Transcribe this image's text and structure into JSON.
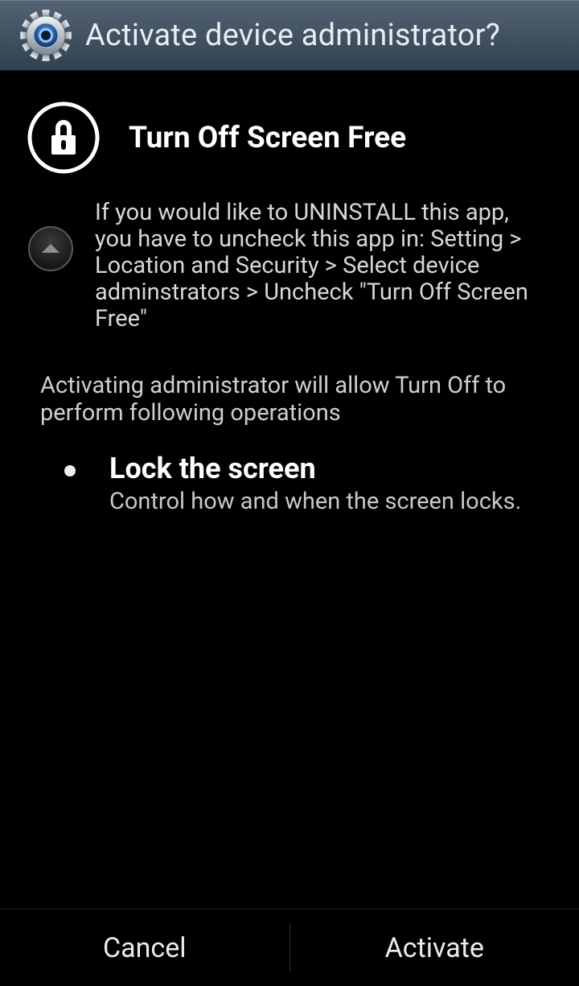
{
  "header": {
    "title": "Activate device administrator?"
  },
  "app": {
    "name": "Turn Off Screen Free",
    "uninstall_note": "If you would like to UNINSTALL this app, you have to uncheck this app in: Setting > Location and Security > Select device adminstrators > Uncheck \"Turn Off Screen Free\""
  },
  "explain": "Activating administrator will allow Turn Off to perform following operations",
  "permissions": [
    {
      "title": "Lock the screen",
      "desc": "Control how and when the screen locks."
    }
  ],
  "buttons": {
    "cancel": "Cancel",
    "activate": "Activate"
  }
}
